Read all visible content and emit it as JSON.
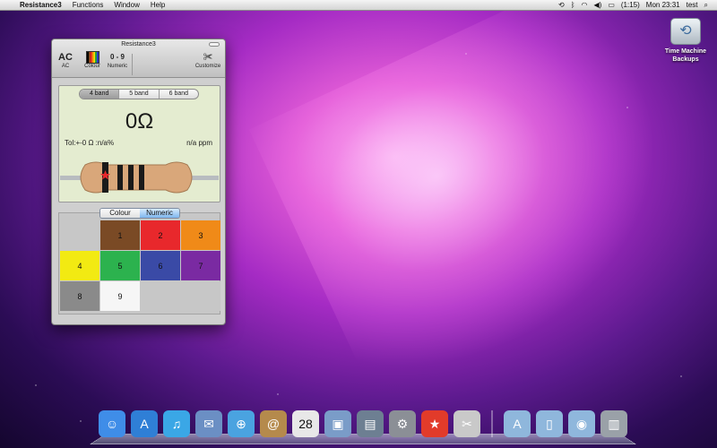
{
  "menubar": {
    "app_name": "Resistance3",
    "menus": [
      "Functions",
      "Window",
      "Help"
    ],
    "battery": "(1:15)",
    "clock": "Mon 23:31",
    "user": "test"
  },
  "desktop": {
    "time_machine_label_line1": "Time Machine",
    "time_machine_label_line2": "Backups"
  },
  "window": {
    "title": "Resistance3",
    "toolbar": {
      "ac_big": "AC",
      "ac_label": "AC",
      "colour_label": "Colour",
      "numeric_big": "0 - 9",
      "numeric_label": "Numeric",
      "customize_label": "Customize"
    },
    "band_tabs": [
      {
        "label": "4 band",
        "selected": true
      },
      {
        "label": "5 band",
        "selected": false
      },
      {
        "label": "6 band",
        "selected": false
      }
    ],
    "value": "0Ω",
    "tolerance": "Tol:+-0 Ω :n/a%",
    "ppm": "n/a ppm",
    "resistor_bands": [
      "#1a1a1a",
      "#1a1a1a",
      "#1a1a1a",
      "#1a1a1a"
    ],
    "mode_tabs": [
      {
        "label": "Colour",
        "selected": false
      },
      {
        "label": "Numeric",
        "selected": true
      }
    ],
    "keypad": [
      {
        "label": "",
        "color": "#c7c7c7"
      },
      {
        "label": "1",
        "color": "#7a4a25"
      },
      {
        "label": "2",
        "color": "#e8282c"
      },
      {
        "label": "3",
        "color": "#f08a18"
      },
      {
        "label": "4",
        "color": "#f2ea12"
      },
      {
        "label": "5",
        "color": "#2cb24e"
      },
      {
        "label": "6",
        "color": "#3a4aa6"
      },
      {
        "label": "7",
        "color": "#7a2aa2"
      },
      {
        "label": "8",
        "color": "#8a8a8a"
      },
      {
        "label": "9",
        "color": "#f6f6f6"
      },
      {
        "label": "",
        "color": "#c7c7c7"
      },
      {
        "label": "",
        "color": "#c7c7c7"
      }
    ]
  },
  "dock": {
    "items": [
      {
        "name": "finder-icon",
        "glyph": "☺",
        "color": "#3f8de8"
      },
      {
        "name": "app-store-icon",
        "glyph": "A",
        "color": "#2f7fd6"
      },
      {
        "name": "itunes-icon",
        "glyph": "♫",
        "color": "#3aa7e6"
      },
      {
        "name": "mail-icon",
        "glyph": "✉",
        "color": "#6b8fc4"
      },
      {
        "name": "safari-icon",
        "glyph": "⊕",
        "color": "#4aa3e0"
      },
      {
        "name": "address-book-icon",
        "glyph": "@",
        "color": "#b58a4c"
      },
      {
        "name": "ical-icon",
        "glyph": "28",
        "color": "#e8e8e8"
      },
      {
        "name": "preview-icon",
        "glyph": "▣",
        "color": "#7a9cc8"
      },
      {
        "name": "iphoto-icon",
        "glyph": "▤",
        "color": "#6d7f92"
      },
      {
        "name": "system-preferences-icon",
        "glyph": "⚙",
        "color": "#8b8f96"
      },
      {
        "name": "resistance3-icon",
        "glyph": "★",
        "color": "#e23b2a"
      },
      {
        "name": "scissors-icon",
        "glyph": "✂",
        "color": "#c9c9c9"
      },
      {
        "name": "separator",
        "glyph": "",
        "color": ""
      },
      {
        "name": "applications-folder-icon",
        "glyph": "A",
        "color": "#8fb7dc"
      },
      {
        "name": "documents-folder-icon",
        "glyph": "▯",
        "color": "#8fb7dc"
      },
      {
        "name": "downloads-folder-icon",
        "glyph": "◉",
        "color": "#8fb7dc"
      },
      {
        "name": "trash-icon",
        "glyph": "▥",
        "color": "#9aa1a8"
      }
    ]
  }
}
